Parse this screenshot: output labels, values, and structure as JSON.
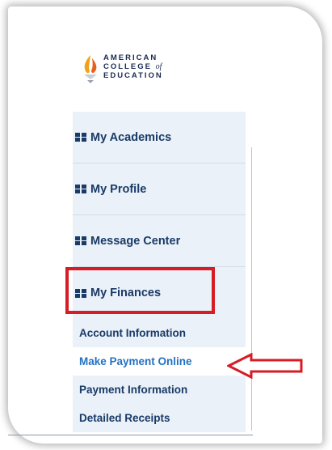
{
  "logo": {
    "line1": "AMERICAN",
    "line2": "COLLEGE",
    "of": "of",
    "line3": "EDUCATION"
  },
  "menu": {
    "items": [
      {
        "label": "My Academics"
      },
      {
        "label": "My Profile"
      },
      {
        "label": "Message Center"
      },
      {
        "label": "My Finances"
      }
    ],
    "finances_subitems": [
      {
        "label": "Account Information"
      },
      {
        "label": "Make Payment Online"
      },
      {
        "label": "Payment Information"
      },
      {
        "label": "Detailed Receipts"
      }
    ]
  },
  "annotations": {
    "highlight_color": "#d61c25",
    "arrow_color": "#d61c25"
  },
  "colors": {
    "nav_text": "#1a3a67",
    "active_link": "#2371c2",
    "menu_bg": "#eaf1f8"
  }
}
